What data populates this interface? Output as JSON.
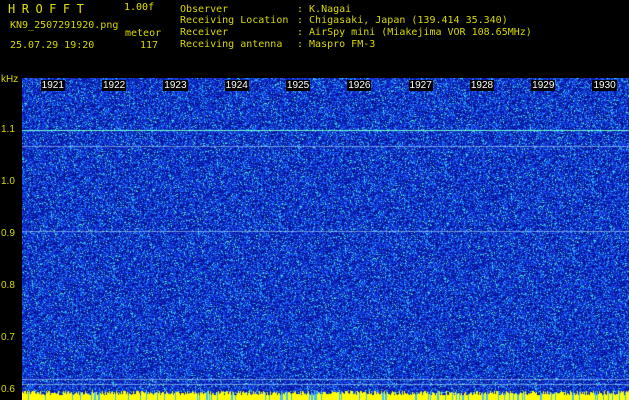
{
  "header": {
    "app_title": "HROFFT",
    "version": "1.00f",
    "filename": "KN9_2507291920.png",
    "mode": "meteor",
    "datetime": "25.07.29 19:20",
    "count": "117"
  },
  "meta": [
    {
      "key": "Observer",
      "value": ": K.Nagai"
    },
    {
      "key": "Receiving Location",
      "value": ": Chigasaki, Japan (139.414 35.340)"
    },
    {
      "key": "Receiver",
      "value": ": AirSpy mini (Miakejima VOR 108.65MHz)"
    },
    {
      "key": "Receiving antenna",
      "value": ": Maspro FM-3"
    }
  ],
  "spectrogram": {
    "unit": "kHz",
    "y_ticks": [
      "1.1",
      "1.0",
      "0.9",
      "0.8",
      "0.7",
      "0.6"
    ],
    "y_range": [
      0.58,
      1.2
    ],
    "x_ticks": [
      "1921",
      "1922",
      "1923",
      "1924",
      "1925",
      "1926",
      "1927",
      "1928",
      "1929",
      "1930"
    ],
    "x_range": [
      1920.5,
      1930.4
    ],
    "horizontal_lines_khz": [
      1.1,
      1.07,
      0.905,
      0.62,
      0.61
    ],
    "colors": {
      "background": "#0a1a9c",
      "noise_low": "#1a5cff",
      "noise_high": "#2ee0e0",
      "line": "#6fffd0",
      "bottom_strip": "#ffff00"
    }
  }
}
